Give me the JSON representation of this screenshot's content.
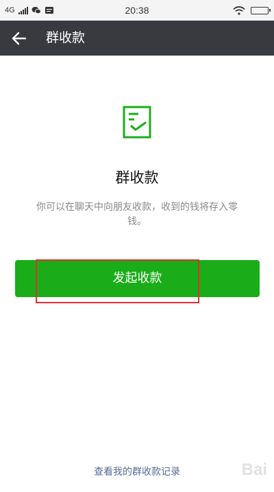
{
  "status_bar": {
    "network": "4G",
    "time": "20:38",
    "icons": [
      "signal-icon",
      "wechat-icon",
      "notification-icon",
      "wifi-icon",
      "battery-icon"
    ]
  },
  "header": {
    "title": "群收款",
    "back_icon": "back-arrow-icon"
  },
  "content": {
    "icon": "document-check-icon",
    "heading": "群收款",
    "description": "你可以在聊天中向朋友收款，收到的钱将存入零钱。",
    "primary_button": "发起收款",
    "records_link": "查看我的群收款记录"
  },
  "watermark": "Bai",
  "colors": {
    "title_bar": "#393a3f",
    "accent_green": "#1aad19",
    "highlight_red": "#e03030",
    "link_blue": "#576b95"
  }
}
